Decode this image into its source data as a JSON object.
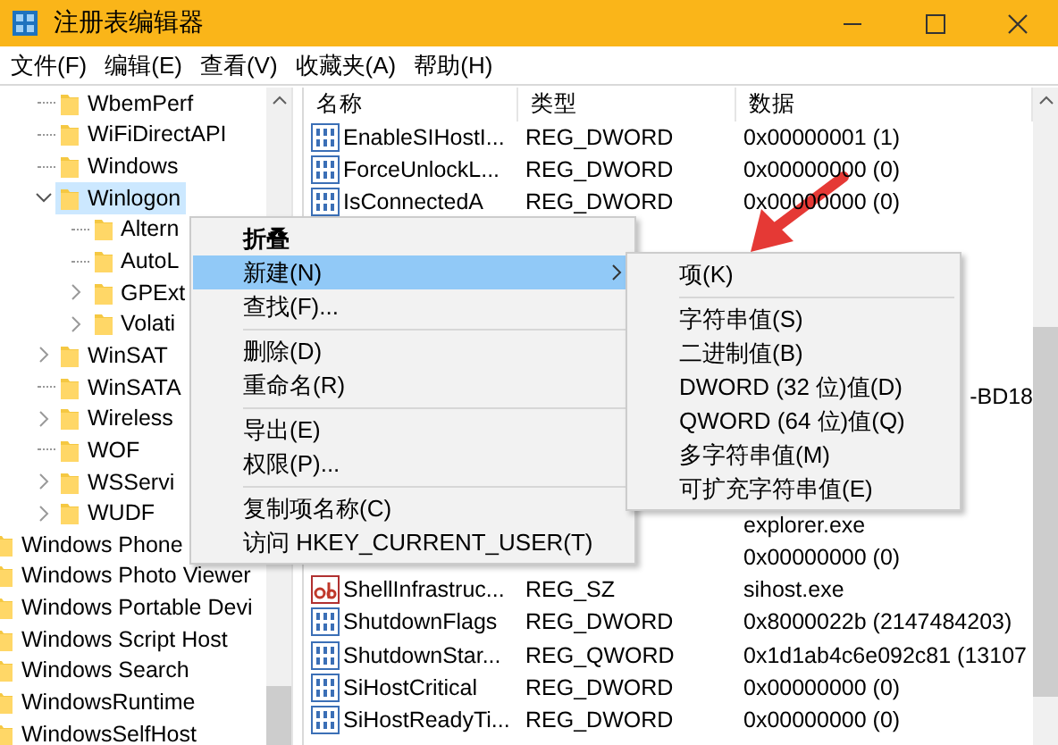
{
  "window": {
    "title": "注册表编辑器"
  },
  "menu_bar": [
    "文件(F)",
    "编辑(E)",
    "查看(V)",
    "收藏夹(A)",
    "帮助(H)"
  ],
  "tree": {
    "items": [
      {
        "children": [
          {
            "children": [
              {
                "label": "WbemPerf",
                "selected": false
              },
              {
                "label": "WiFiDirectAPI",
                "selected": false
              },
              {
                "label": "Windows",
                "selected": false
              },
              {
                "label": "Winlogon",
                "selected": true,
                "expanded": true,
                "children": [
                  {
                    "label": "Altern",
                    "selected": false
                  },
                  {
                    "label": "AutoL",
                    "selected": false
                  },
                  {
                    "label": "GPExt",
                    "selected": false,
                    "expanded": false
                  },
                  {
                    "label": "Volati",
                    "selected": false,
                    "expanded": false
                  }
                ]
              },
              {
                "label": "WinSAT",
                "selected": false,
                "expanded": false
              },
              {
                "label": "WinSATA",
                "selected": false
              },
              {
                "label": "Wireless",
                "selected": false,
                "expanded": false
              },
              {
                "label": "WOF",
                "selected": false
              },
              {
                "label": "WSServi",
                "selected": false,
                "expanded": false
              },
              {
                "label": "WUDF",
                "selected": false,
                "expanded": false
              }
            ]
          }
        ]
      },
      {
        "label": "Windows Phone",
        "selected": false
      },
      {
        "label": "Windows Photo Viewer",
        "selected": false
      },
      {
        "label": "Windows Portable Devi",
        "selected": false
      },
      {
        "label": "Windows Script Host",
        "selected": false
      },
      {
        "label": "Windows Search",
        "selected": false
      },
      {
        "label": "WindowsRuntime",
        "selected": false
      },
      {
        "label": "WindowsSelfHost",
        "selected": false
      }
    ]
  },
  "table": {
    "columns": [
      "名称",
      "类型",
      "数据"
    ],
    "rows": [
      {
        "kind": "binary",
        "name": "EnableSIHostI...",
        "type": "REG_DWORD",
        "data": "0x00000001 (1)"
      },
      {
        "kind": "binary",
        "name": "ForceUnlockL...",
        "type": "REG_DWORD",
        "data": "0x00000000 (0)"
      },
      {
        "kind": "binary",
        "name": "IsConnectedA",
        "type": "REG_DWORD",
        "data": "0x00000000 (0)"
      },
      {},
      {},
      {},
      {},
      {},
      {
        "data": "-BD18"
      },
      {},
      {},
      {},
      {
        "data": "explorer.exe"
      },
      {
        "data": "0x00000000 (0)"
      },
      {
        "kind": "string",
        "name": "ShellInfrastruc...",
        "type": "REG_SZ",
        "data": "sihost.exe"
      },
      {
        "kind": "binary",
        "name": "ShutdownFlags",
        "type": "REG_DWORD",
        "data": "0x8000022b (2147484203)"
      },
      {
        "kind": "binary",
        "name": "ShutdownStar...",
        "type": "REG_QWORD",
        "data": "0x1d1ab4c6e092c81 (13107"
      },
      {
        "kind": "binary",
        "name": "SiHostCritical",
        "type": "REG_DWORD",
        "data": "0x00000000 (0)"
      },
      {
        "kind": "binary",
        "name": "SiHostReadyTi...",
        "type": "REG_DWORD",
        "data": "0x00000000 (0)"
      }
    ]
  },
  "context_menu": {
    "items": [
      {
        "kind": "item",
        "label": "折叠",
        "bold": true,
        "selected": false
      },
      {
        "kind": "item",
        "label": "新建(N)",
        "selected": true,
        "has_submenu": true
      },
      {
        "kind": "item",
        "label": "查找(F)...",
        "selected": false
      },
      {
        "kind": "separator"
      },
      {
        "kind": "item",
        "label": "删除(D)",
        "selected": false
      },
      {
        "kind": "item",
        "label": "重命名(R)",
        "selected": false
      },
      {
        "kind": "separator"
      },
      {
        "kind": "item",
        "label": "导出(E)",
        "selected": false
      },
      {
        "kind": "item",
        "label": "权限(P)...",
        "selected": false
      },
      {
        "kind": "separator"
      },
      {
        "kind": "item",
        "label": "复制项名称(C)",
        "selected": false
      },
      {
        "kind": "item",
        "label": "访问 HKEY_CURRENT_USER(T)",
        "selected": false
      }
    ]
  },
  "submenu": {
    "items": [
      {
        "kind": "item",
        "label": "项(K)",
        "selected": false
      },
      {
        "kind": "separator"
      },
      {
        "kind": "item",
        "label": "字符串值(S)",
        "selected": false
      },
      {
        "kind": "item",
        "label": "二进制值(B)",
        "selected": false
      },
      {
        "kind": "item",
        "label": "DWORD (32 位)值(D)",
        "selected": false
      },
      {
        "kind": "item",
        "label": "QWORD (64 位)值(Q)",
        "selected": false
      },
      {
        "kind": "item",
        "label": "多字符串值(M)",
        "selected": false
      },
      {
        "kind": "item",
        "label": "可扩充字符串值(E)",
        "selected": false
      }
    ]
  }
}
